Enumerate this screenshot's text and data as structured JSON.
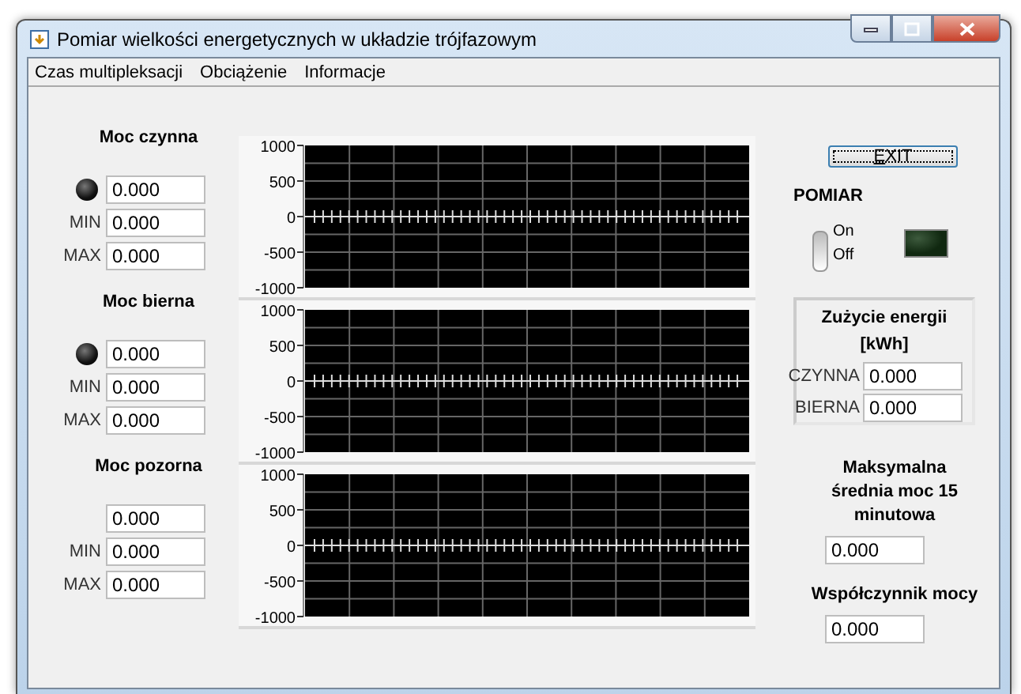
{
  "window": {
    "title": "Pomiar wielkości energetycznych w układzie trójfazowym"
  },
  "menu": [
    "Czas multipleksacji",
    "Obciążenie",
    "Informacje"
  ],
  "meters": [
    {
      "title": "Moc czynna",
      "indicator_on": false,
      "value": "0.000",
      "min_label": "MIN",
      "min": "0.000",
      "max_label": "MAX",
      "max": "0.000",
      "graph_axis_labels": [
        "1000",
        "500",
        "0",
        "-500",
        "-1000"
      ]
    },
    {
      "title": "Moc bierna",
      "indicator_on": false,
      "value": "0.000",
      "min_label": "MIN",
      "min": "0.000",
      "max_label": "MAX",
      "max": "0.000",
      "graph_axis_labels": [
        "1000",
        "500",
        "0",
        "-500",
        "-1000"
      ]
    },
    {
      "title": "Moc pozorna",
      "value": "0.000",
      "min_label": "MIN",
      "min": "0.000",
      "max_label": "MAX",
      "max": "0.000",
      "graph_axis_labels": [
        "1000",
        "500",
        "0",
        "-500",
        "-1000"
      ]
    }
  ],
  "exit_button": "EXIT",
  "pomiar": {
    "title": "POMIAR",
    "on_label": "On",
    "off_label": "Off",
    "on": false,
    "lamp_on": false
  },
  "energy": {
    "title": "Zużycie energii",
    "unit": "[kWh]",
    "fields": [
      {
        "label": "CZYNNA",
        "value": "0.000"
      },
      {
        "label": "BIERNA",
        "value": "0.000"
      }
    ]
  },
  "max_average": {
    "label": "Maksymalna średnia moc 15 minutowa",
    "value": "0.000"
  },
  "power_factor": {
    "label": "Współczynnik mocy",
    "value": "0.000"
  }
}
